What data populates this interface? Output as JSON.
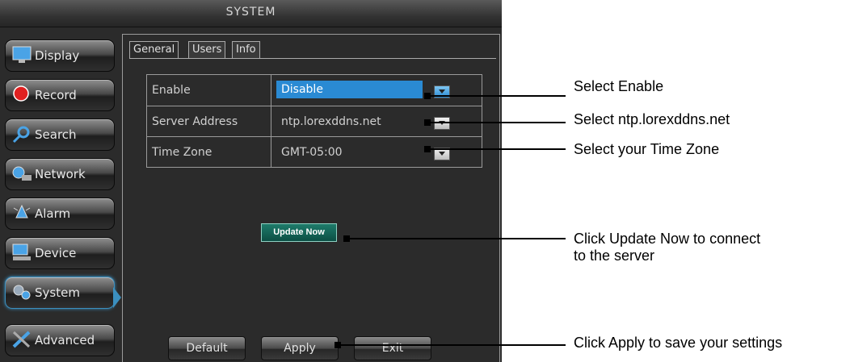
{
  "window": {
    "title": "SYSTEM"
  },
  "menu": [
    {
      "label": "Display",
      "icon": "monitor-icon"
    },
    {
      "label": "Record",
      "icon": "record-icon"
    },
    {
      "label": "Search",
      "icon": "search-icon"
    },
    {
      "label": "Network",
      "icon": "network-icon"
    },
    {
      "label": "Alarm",
      "icon": "alarm-icon"
    },
    {
      "label": "Device",
      "icon": "device-icon"
    },
    {
      "label": "System",
      "icon": "system-icon",
      "active": true
    },
    {
      "label": "Advanced",
      "icon": "advanced-icon"
    }
  ],
  "tabs": [
    {
      "label": "General",
      "active": true
    },
    {
      "label": "Users"
    },
    {
      "label": "Info"
    }
  ],
  "settings": [
    {
      "label": "Enable",
      "value": "Disable"
    },
    {
      "label": "Server Address",
      "value": "ntp.lorexddns.net"
    },
    {
      "label": "Time Zone",
      "value": "GMT-05:00"
    }
  ],
  "buttons": {
    "update_now": "Update Now",
    "default": "Default",
    "apply": "Apply",
    "exit": "Exit"
  },
  "annotations": {
    "enable": "Select Enable",
    "server": "Select ntp.lorexddns.net",
    "timezone": "Select your Time Zone",
    "update_line1": "Click Update Now to connect",
    "update_line2": "to the server",
    "apply": "Click Apply to save your settings"
  },
  "colors": {
    "selection": "#2a8ad3",
    "active_menu": "#3b8fbf",
    "update_button": "#1e7b6b"
  }
}
